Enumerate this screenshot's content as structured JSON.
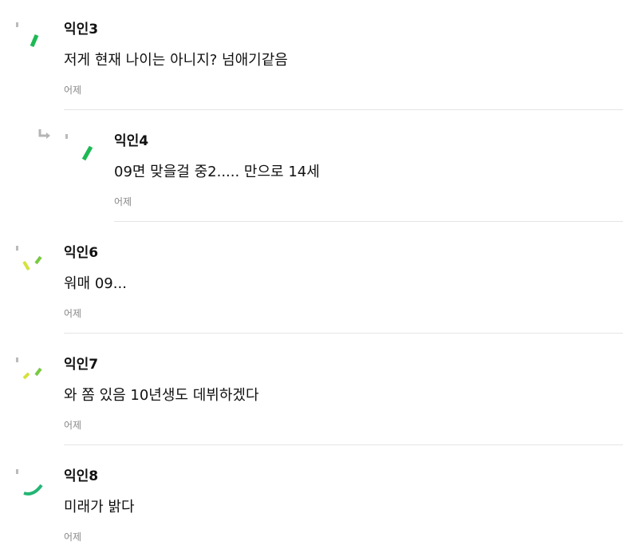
{
  "comments": [
    {
      "author": "익인3",
      "text": "저게 현재 나이는 아니지? 넘애기같음",
      "time": "어제",
      "avatar_color": "#1db954",
      "is_reply": false
    },
    {
      "author": "익인4",
      "text": "09면 맞을걸 중2..... 만으로 14세",
      "time": "어제",
      "avatar_color": "#1db954",
      "is_reply": true
    },
    {
      "author": "익인6",
      "text": "워매 09...",
      "time": "어제",
      "avatar_color": "#b7d63a",
      "is_reply": false
    },
    {
      "author": "익인7",
      "text": "와 쫌 있음 10년생도 데뷔하겠다",
      "time": "어제",
      "avatar_color": "#b7d63a",
      "is_reply": false
    },
    {
      "author": "익인8",
      "text": "미래가 밝다",
      "time": "어제",
      "avatar_color": "#22b573",
      "is_reply": false
    }
  ],
  "icons": {
    "reply": "reply-arrow-icon",
    "avatar": "avatar-icon"
  }
}
